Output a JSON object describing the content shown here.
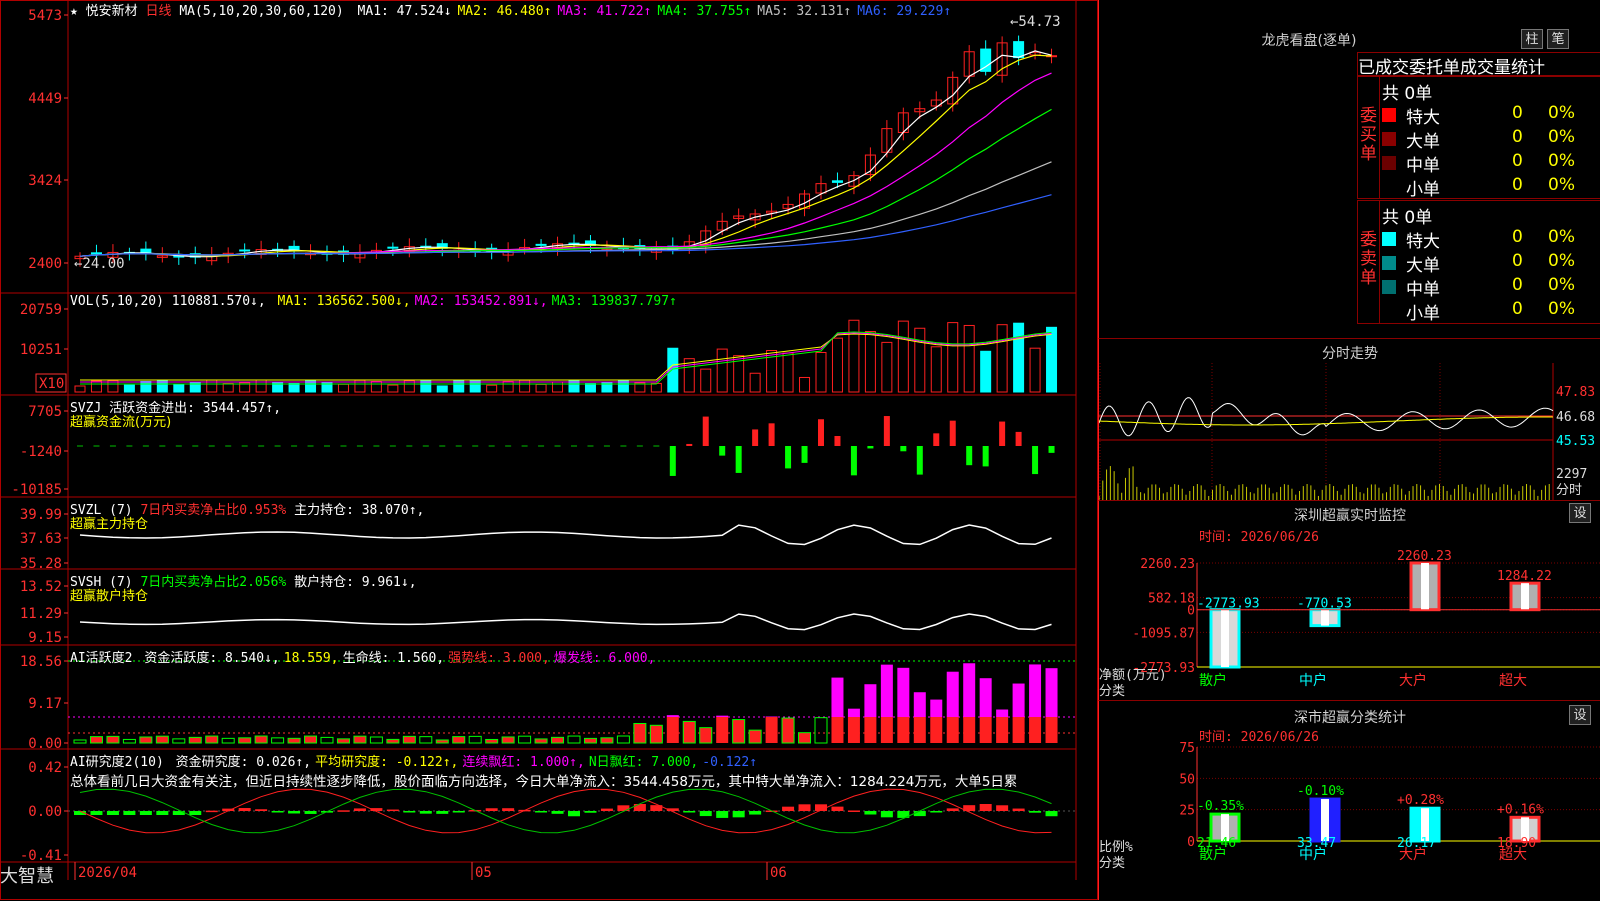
{
  "app_name": "大智慧",
  "stock": {
    "name": "悦安新材",
    "period": "日线"
  },
  "main_panel": {
    "ma_params": "MA(5,10,20,30,60,120)",
    "ma": [
      {
        "label": "MA1:",
        "value": "47.524↓",
        "color": "#ffffff"
      },
      {
        "label": "MA2:",
        "value": "46.480↑",
        "color": "#ffff00"
      },
      {
        "label": "MA3:",
        "value": "41.722↑",
        "color": "#ff00ff"
      },
      {
        "label": "MA4:",
        "value": "37.755↑",
        "color": "#00ff00"
      },
      {
        "label": "MA5:",
        "value": "32.131↑",
        "color": "#c0c0c0"
      },
      {
        "label": "MA6:",
        "value": "29.229↑",
        "color": "#3060ff"
      }
    ],
    "y_ticks": [
      "5473",
      "4449",
      "3424",
      "2400"
    ],
    "high_marker": "54.73",
    "low_marker": "24.00"
  },
  "vol_panel": {
    "title": "VOL(5,10,20)",
    "value": "110881.570↓,",
    "ma": [
      {
        "label": "MA1:",
        "value": "136562.500↓,",
        "color": "#ffff00"
      },
      {
        "label": "MA2:",
        "value": "153452.891↓,",
        "color": "#ff00ff"
      },
      {
        "label": "MA3:",
        "value": "139837.797↑",
        "color": "#00ff00"
      }
    ],
    "y_ticks": [
      "20759",
      "10251"
    ],
    "unit_label": "X10"
  },
  "svzj_panel": {
    "title": "SVZJ  活跃资金进出: 3544.457↑,",
    "subtitle": "超赢资金流(万元)",
    "y_ticks": [
      "7705",
      "-1240",
      "-10185"
    ]
  },
  "svzl_panel": {
    "title": "SVZL (7)",
    "pct": "7日内买卖净占比0.953%",
    "hold": "主力持仓: 38.070↑,",
    "subtitle": "超赢主力持仓",
    "y_ticks": [
      "39.99",
      "37.63",
      "35.28"
    ]
  },
  "svsh_panel": {
    "title": "SVSH (7)",
    "pct": "7日内买卖净占比2.056%",
    "hold": "散户持仓: 9.961↓,",
    "subtitle": "超赢散户持仓",
    "y_ticks": [
      "13.52",
      "11.29",
      "9.15"
    ]
  },
  "ai_act_panel": {
    "title": "AI活跃度2",
    "items": [
      {
        "text": "资金活跃度: 8.540↓,",
        "color": "#ffffff"
      },
      {
        "text": "18.559,",
        "color": "#ffff00"
      },
      {
        "text": "生命线: 1.560,",
        "color": "#ffffff"
      },
      {
        "text": "强势线: 3.000,",
        "color": "#ff3030"
      },
      {
        "text": "爆发线: 6.000,",
        "color": "#ff00ff"
      }
    ],
    "y_ticks": [
      "18.56",
      "9.17",
      "0.00"
    ]
  },
  "ai_research_panel": {
    "title": "AI研究度2(10)",
    "items": [
      {
        "text": "资金研究度: 0.026↑,",
        "color": "#ffffff"
      },
      {
        "text": "平均研究度: -0.122↑,",
        "color": "#ffff00"
      },
      {
        "text": "连续飘红: 1.000↑,",
        "color": "#ff00ff"
      },
      {
        "text": "N日飘红: 7.000,",
        "color": "#00ff00"
      },
      {
        "text": "-0.122↑",
        "color": "#3060ff"
      }
    ],
    "summary": "总体看前几日大资金有关注，但近日持续性逐步降低，股价面临方向选择，今日大单净流入：3544.458万元，其中特大单净流入：1284.224万元，大单5日累",
    "y_ticks": [
      "0.42",
      "0.00",
      "-0.41"
    ]
  },
  "x_axis": {
    "labels": [
      "2026/04",
      "05",
      "06"
    ]
  },
  "right": {
    "dragon_title": "龙虎看盘(逐单)",
    "btn_bar": "柱",
    "btn_pen": "笔",
    "trade_header": "已成交委托单成交量统计",
    "buy": {
      "side_label": "委买单",
      "total": "共 0单",
      "rows": [
        {
          "name": "特大",
          "count": "0",
          "pct": "0%",
          "color": "#ff0000"
        },
        {
          "name": "大单",
          "count": "0",
          "pct": "0%",
          "color": "#8b0000"
        },
        {
          "name": "中单",
          "count": "0",
          "pct": "0%",
          "color": "#6b0000"
        },
        {
          "name": "小单",
          "count": "0",
          "pct": "0%",
          "color": ""
        }
      ]
    },
    "sell": {
      "side_label": "委卖单",
      "total": "共 0单",
      "rows": [
        {
          "name": "特大",
          "count": "0",
          "pct": "0%",
          "color": "#00ffff"
        },
        {
          "name": "大单",
          "count": "0",
          "pct": "0%",
          "color": "#008b8b"
        },
        {
          "name": "中单",
          "count": "0",
          "pct": "0%",
          "color": "#007070"
        },
        {
          "name": "小单",
          "count": "0",
          "pct": "0%",
          "color": ""
        }
      ]
    },
    "intraday": {
      "title": "分时走势",
      "y_ticks": [
        "47.83",
        "46.68",
        "45.53"
      ],
      "vol_tick": "2297",
      "vol_label": "分时"
    },
    "monitor": {
      "title": "深圳超赢实时监控",
      "settings": "设",
      "time": "时间: 2026/06/26",
      "y_ticks": [
        "2260.23",
        "582.18",
        "0",
        "-1095.87",
        "-2773.93"
      ],
      "ylabel": "净额(万元)",
      "xlabel": "分类",
      "categories": [
        "散户",
        "中户",
        "大户",
        "超大"
      ],
      "values": [
        -2773.93,
        -770.53,
        2260.23,
        1284.22
      ],
      "value_labels": [
        "-2773.93",
        "-770.53",
        "2260.23",
        "1284.22"
      ]
    },
    "classify": {
      "title": "深市超赢分类统计",
      "settings": "设",
      "time": "时间: 2026/06/26",
      "y_ticks": [
        "75",
        "50",
        "25",
        "0"
      ],
      "ylabel": "比例%",
      "xlabel": "分类",
      "categories": [
        "散户",
        "中户",
        "大户",
        "超大"
      ],
      "values": [
        21.46,
        33.47,
        26.17,
        18.9
      ],
      "changes": [
        "-0.35%",
        "-0.10%",
        "+0.28%",
        "+0.16%"
      ],
      "value_labels": [
        "21.46",
        "33.47",
        "26.17",
        "18.90"
      ]
    }
  },
  "chart_data": [
    {
      "type": "bar",
      "title": "深圳超赢实时监控",
      "categories": [
        "散户",
        "中户",
        "大户",
        "超大"
      ],
      "values": [
        -2773.93,
        -770.53,
        2260.23,
        1284.22
      ],
      "xlabel": "分类",
      "ylabel": "净额(万元)",
      "ylim": [
        -2773.93,
        2260.23
      ]
    },
    {
      "type": "bar",
      "title": "深市超赢分类统计",
      "categories": [
        "散户",
        "中户",
        "大户",
        "超大"
      ],
      "values": [
        21.46,
        33.47,
        26.17,
        18.9
      ],
      "xlabel": "分类",
      "ylabel": "比例%",
      "ylim": [
        0,
        75
      ]
    }
  ]
}
